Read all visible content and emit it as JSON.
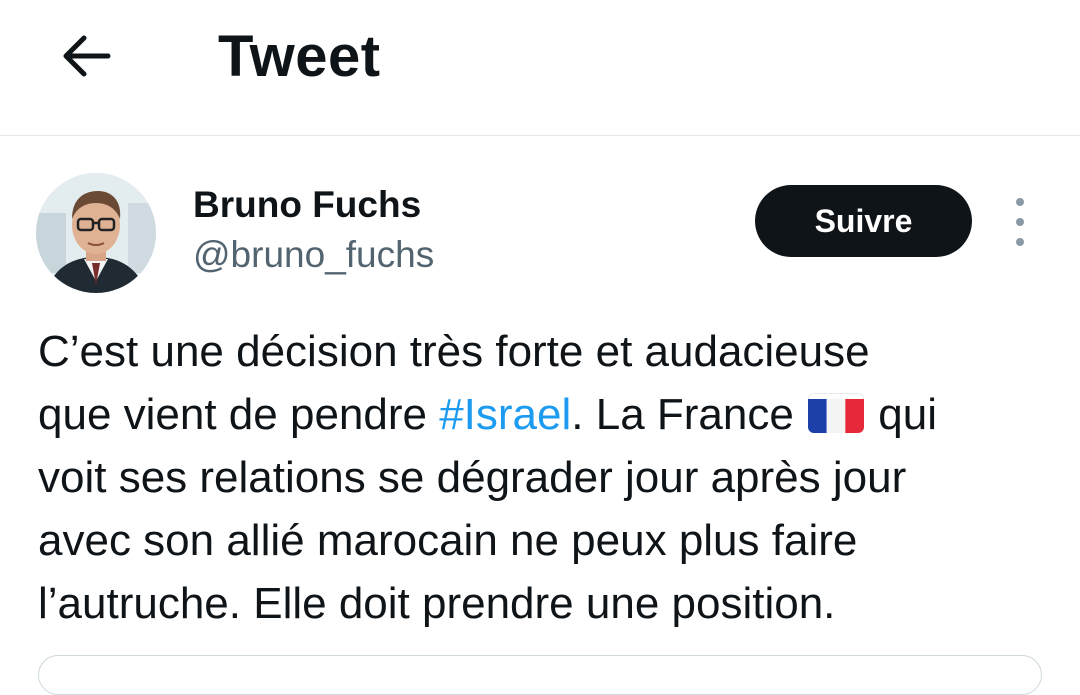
{
  "header": {
    "title": "Tweet",
    "back_icon": "arrow-left-icon"
  },
  "author": {
    "name": "Bruno Fuchs",
    "handle": "@bruno_fuchs",
    "follow_label": "Suivre",
    "more_icon": "vertical-dots-icon"
  },
  "tweet": {
    "line1": "C’est une décision très forte et audacieuse",
    "line2_pre": "que vient de pendre ",
    "hashtag": "#Israel",
    "line2_mid": ". La France ",
    "flag_icon": "france-flag-emoji",
    "line2_post": " qui",
    "line3": "voit ses relations se dégrader jour après jour",
    "line4": "avec son allié marocain ne peux plus faire",
    "line5": "l’autruche. Elle doit prendre une position."
  },
  "colors": {
    "text": "#0f1419",
    "secondary": "#536471",
    "link": "#1d9bf0",
    "button_bg": "#0f1419"
  }
}
